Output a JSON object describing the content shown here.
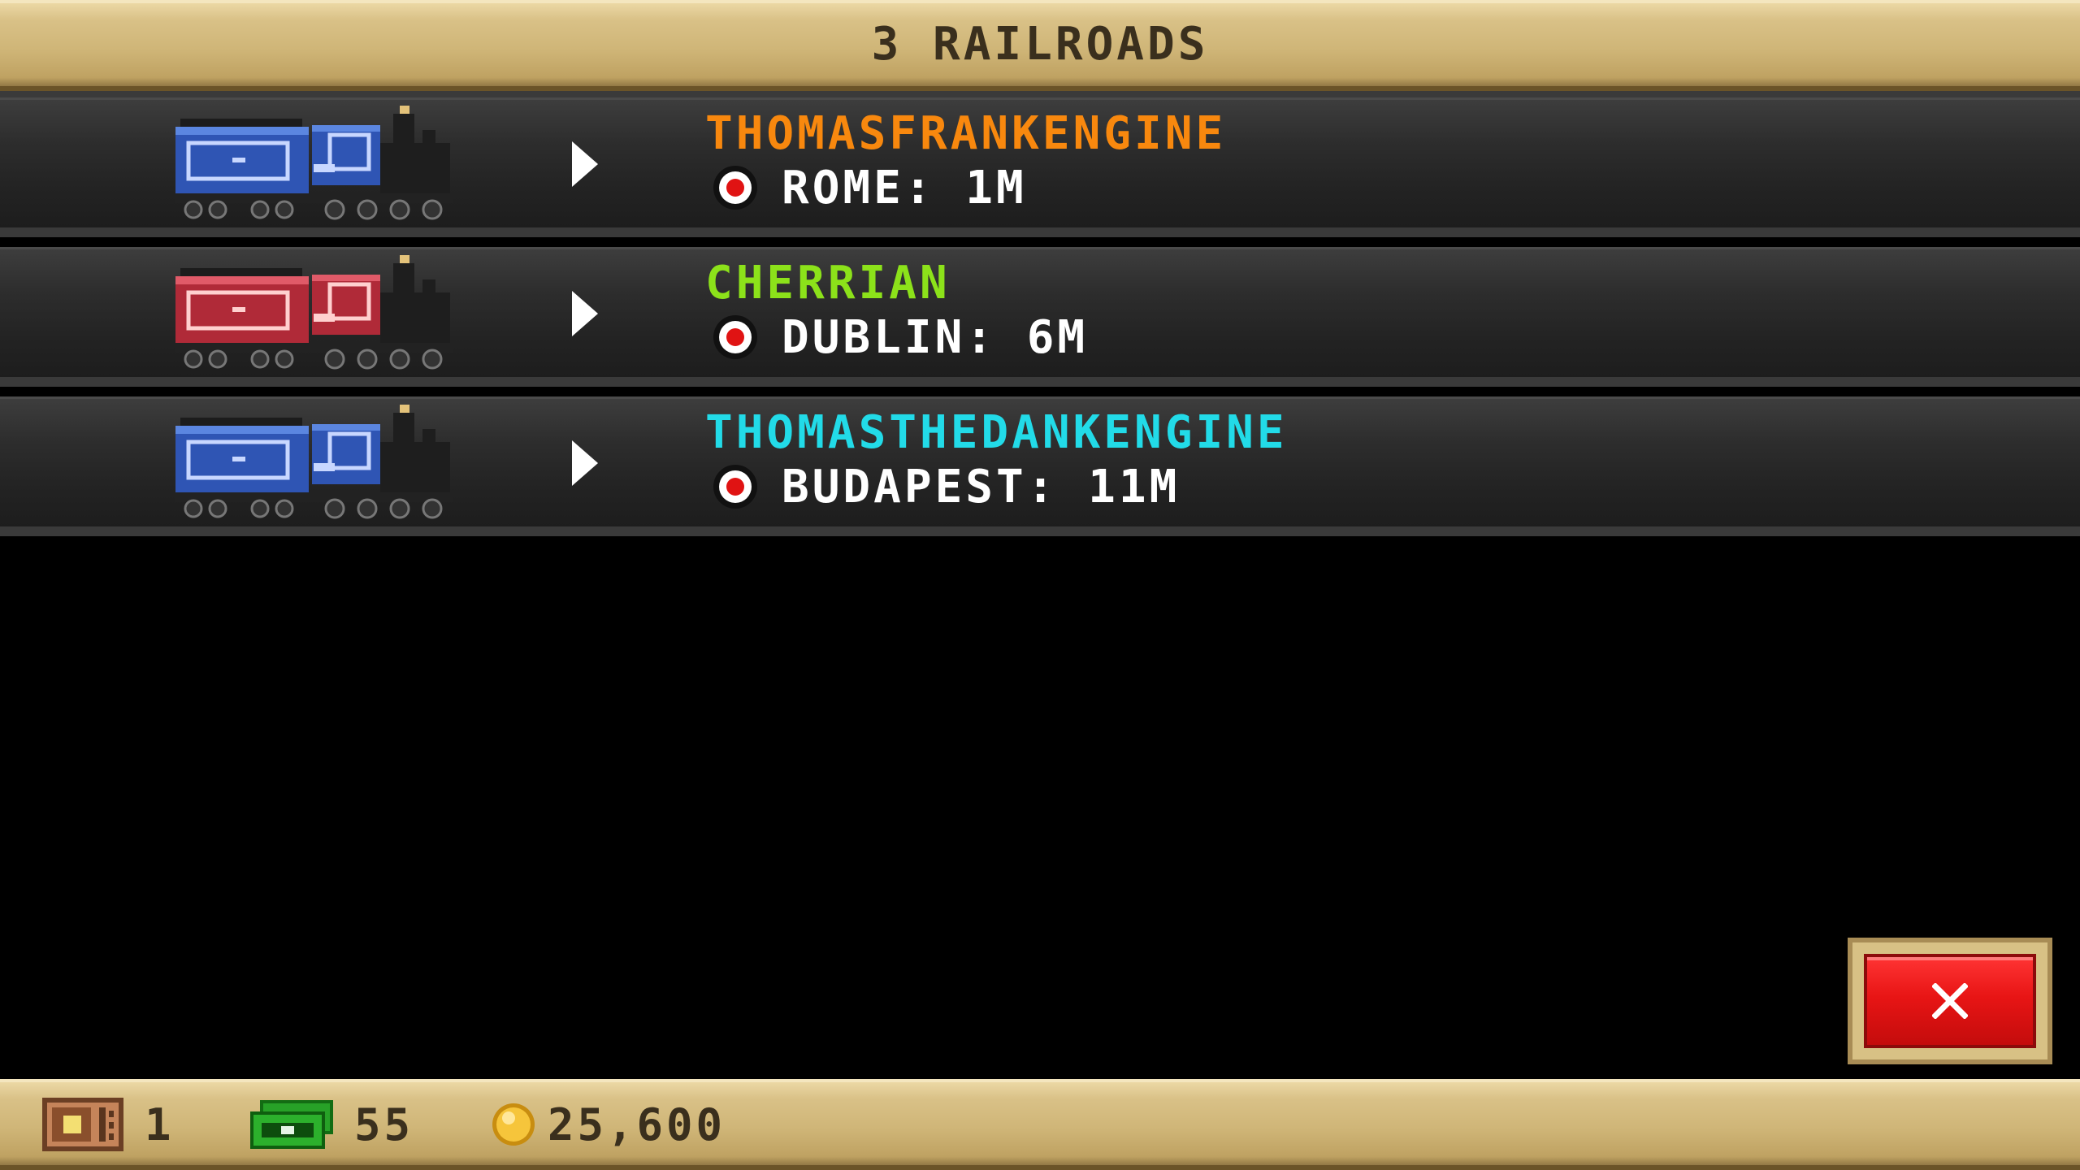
{
  "header": {
    "title": "3 RAILROADS"
  },
  "railroads": [
    {
      "name": "THOMASFRANKENGINE",
      "location": "ROME: 1M",
      "name_color": "#f8880e",
      "train_color": "blue"
    },
    {
      "name": "CHERRIAN",
      "location": "DUBLIN: 6M",
      "name_color": "#8ce21a",
      "train_color": "red"
    },
    {
      "name": "THOMASTHEDANKENGINE",
      "location": "BUDAPEST: 11M",
      "name_color": "#22dbe8",
      "train_color": "blue"
    }
  ],
  "currency": {
    "tickets": "1",
    "cash": "55",
    "coins": "25,600"
  },
  "icons": {
    "train": "steam-locomotive-icon",
    "arrow": "play-arrow-icon",
    "location": "location-pin-icon",
    "close": "close-x-icon",
    "tickets": "ticket-icon",
    "cash": "cash-icon",
    "coins": "coin-icon"
  },
  "colors": {
    "beam": "#d9c187",
    "close_button": "#e81515",
    "row": "#2d2d2d"
  }
}
